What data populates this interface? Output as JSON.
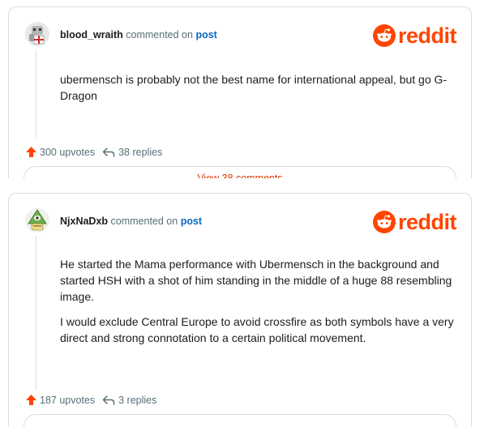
{
  "brand": {
    "wordmark": "reddit",
    "accent": "#ff4500",
    "link_color": "#0a66c2"
  },
  "comments": [
    {
      "username": "blood_wraith",
      "action_text": "commented on",
      "post_link": "post",
      "avatar_icon": "blood-wraith-avatar-icon",
      "body": [
        "ubermensch is probably not the best name for international appeal, but go G-Dragon"
      ],
      "upvotes": "300 upvotes",
      "replies": "38 replies",
      "view_button": "View 38 comments"
    },
    {
      "username": "NjxNaDxb",
      "action_text": "commented on",
      "post_link": "post",
      "avatar_icon": "njxnadxb-avatar-icon",
      "body": [
        "He started the Mama performance with Ubermensch in the background and started HSH with a shot of him standing in the middle of a huge 88 resembling image.",
        "I would exclude Central Europe to avoid crossfire as both symbols have a very direct and strong connotation to a certain political movement."
      ],
      "upvotes": "187 upvotes",
      "replies": "3 replies"
    }
  ]
}
